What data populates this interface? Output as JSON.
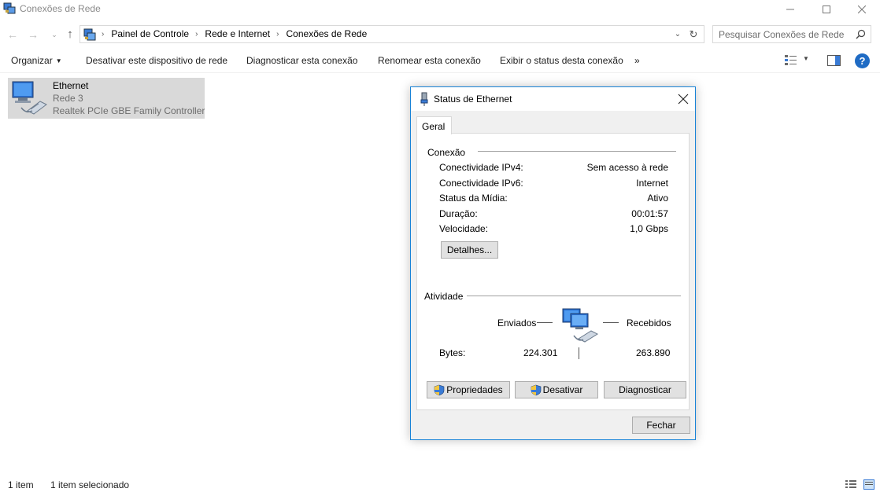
{
  "window": {
    "title": "Conexões de Rede",
    "app_icon": "network-connections-icon",
    "controls": [
      "minimize-icon",
      "maximize-icon",
      "close-icon"
    ]
  },
  "address": {
    "breadcrumbs": [
      "Painel de Controle",
      "Rede e Internet",
      "Conexões de Rede"
    ],
    "search_placeholder": "Pesquisar Conexões de Rede"
  },
  "commandbar": {
    "organize": "Organizar",
    "items": [
      "Desativar este dispositivo de rede",
      "Diagnosticar esta conexão",
      "Renomear esta conexão",
      "Exibir o status desta conexão"
    ],
    "more": "»",
    "help": "?"
  },
  "connection": {
    "name": "Ethernet",
    "network": "Rede  3",
    "device": "Realtek PCIe GBE Family Controller",
    "selected": true
  },
  "statusbar": {
    "count": "1 item",
    "selected": "1 item selecionado"
  },
  "dialog": {
    "title": "Status de Ethernet",
    "tab": "Geral",
    "connection_group": "Conexão",
    "rows": [
      {
        "label": "Conectividade IPv4:",
        "value": "Sem acesso à rede"
      },
      {
        "label": "Conectividade IPv6:",
        "value": "Internet"
      },
      {
        "label": "Status da Mídia:",
        "value": "Ativo"
      },
      {
        "label": "Duração:",
        "value": "00:01:57"
      },
      {
        "label": "Velocidade:",
        "value": "1,0 Gbps"
      }
    ],
    "details_button": "Detalhes...",
    "activity_group": "Atividade",
    "sent_label": "Enviados",
    "received_label": "Recebidos",
    "bytes_label": "Bytes:",
    "bytes_sent": "224.301",
    "bytes_received": "263.890",
    "buttons": {
      "properties": "Propriedades",
      "disable": "Desativar",
      "diagnose": "Diagnosticar"
    },
    "close_button": "Fechar"
  }
}
